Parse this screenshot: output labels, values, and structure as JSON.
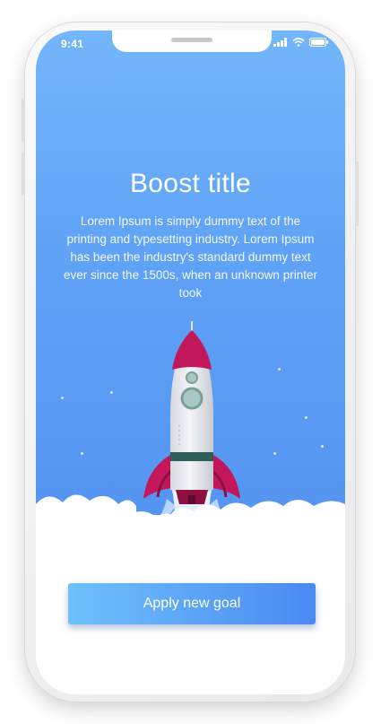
{
  "status_bar": {
    "time": "9:41",
    "icons": [
      "signal-icon",
      "wifi-icon",
      "battery-icon"
    ]
  },
  "onboarding": {
    "title": "Boost title",
    "body": "Lorem Ipsum is simply dummy text of the printing and typesetting industry. Lorem Ipsum has been the industry's standard dummy text ever since the 1500s, when an unknown printer took",
    "illustration": "rocket-illustration",
    "button_label": "Apply new goal"
  },
  "colors": {
    "sky_top": "#73b6fb",
    "sky_bottom": "#5494f2",
    "button_start": "#6ec1fb",
    "button_end": "#4a89f1",
    "rocket_wing": "#c2185b"
  }
}
